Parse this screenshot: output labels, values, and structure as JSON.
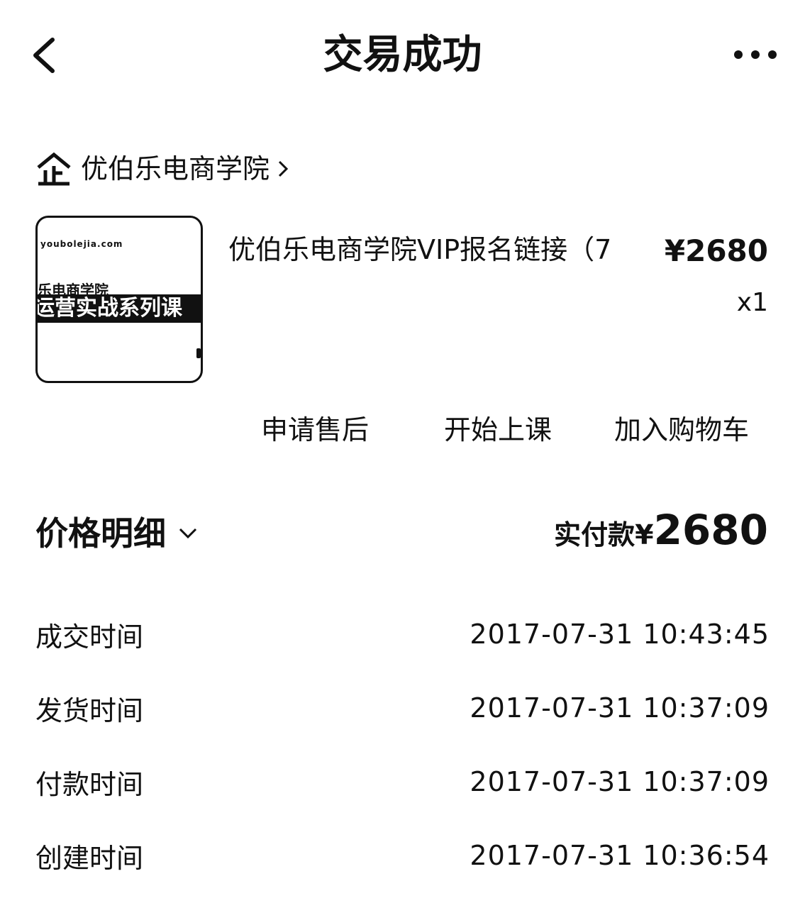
{
  "header": {
    "title": "交易成功",
    "back_icon": "chevron-left-icon",
    "more_icon": "more-dots-icon"
  },
  "shop": {
    "icon": "enterprise-shop-icon",
    "name": "优伯乐电商学院",
    "arrow_icon": "chevron-right-icon"
  },
  "product": {
    "thumbnail": {
      "line1": "youbolejia.com",
      "line2": "乐电商学院",
      "line3": "运营实战系列课"
    },
    "name": "优伯乐电商学院VIP报名链接（7",
    "price": "¥2680",
    "quantity": "x1"
  },
  "actions": {
    "after_sale": "申请售后",
    "start_class": "开始上课",
    "add_to_cart": "加入购物车"
  },
  "price_detail": {
    "label": "价格明细",
    "chevron_icon": "chevron-down-icon",
    "paid_label": "实付款",
    "paid_currency": "¥",
    "paid_amount": "2680"
  },
  "times": [
    {
      "label": "成交时间",
      "value": "2017-07-31 10:43:45"
    },
    {
      "label": "发货时间",
      "value": "2017-07-31 10:37:09"
    },
    {
      "label": "付款时间",
      "value": "2017-07-31 10:37:09"
    },
    {
      "label": "创建时间",
      "value": "2017-07-31 10:36:54"
    }
  ],
  "colors": {
    "text": "#111111",
    "background": "#ffffff"
  }
}
